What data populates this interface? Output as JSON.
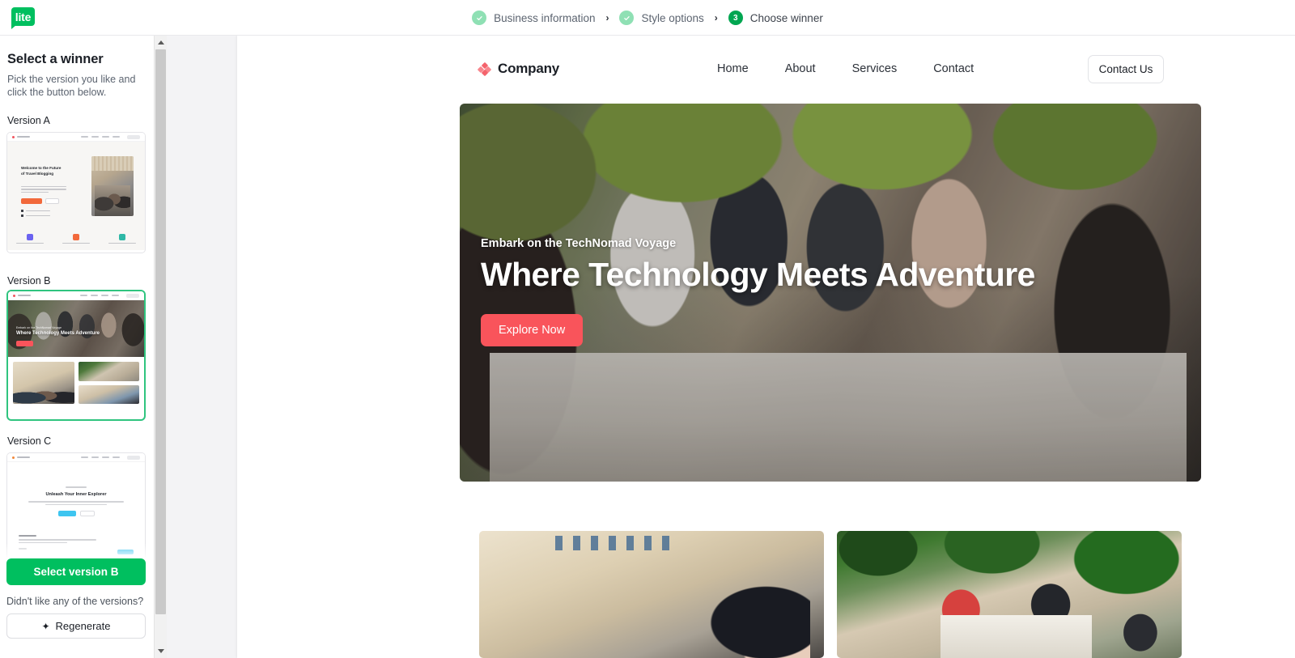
{
  "app": {
    "logo_text": "lite"
  },
  "stepper": {
    "separator": "›",
    "steps": [
      {
        "label": "Business information",
        "state": "done",
        "mark": "✓"
      },
      {
        "label": "Style options",
        "state": "done",
        "mark": "✓"
      },
      {
        "label": "Choose winner",
        "state": "active",
        "mark": "3"
      }
    ]
  },
  "sidebar": {
    "title": "Select a winner",
    "subtitle": "Pick the version you like and click the button below.",
    "versions": [
      {
        "label": "Version A",
        "selected": false,
        "headline": "Welcome to the Future of Travel Blogging"
      },
      {
        "label": "Version B",
        "selected": true,
        "kicker": "Embark on the TechNomad Voyage",
        "headline": "Where Technology Meets Adventure"
      },
      {
        "label": "Version C",
        "selected": false,
        "headline": "Unleash Your Inner Explorer"
      }
    ],
    "select_button": "Select version B",
    "regenerate_prompt": "Didn't like any of the versions?",
    "regenerate_button": "Regenerate",
    "regenerate_icon": "✦"
  },
  "preview": {
    "brand": "Company",
    "nav_links": [
      "Home",
      "About",
      "Services",
      "Contact"
    ],
    "contact_button": "Contact Us",
    "hero": {
      "kicker": "Embark on the TechNomad Voyage",
      "title": "Where Technology Meets Adventure",
      "cta": "Explore Now",
      "cta_color": "#f9545b"
    }
  },
  "colors": {
    "brand_green": "#00bf5f",
    "step_done": "#8fe0b4",
    "step_active": "#00a651",
    "selected_border": "#2fc47f",
    "accent_coral": "#f9545b"
  }
}
